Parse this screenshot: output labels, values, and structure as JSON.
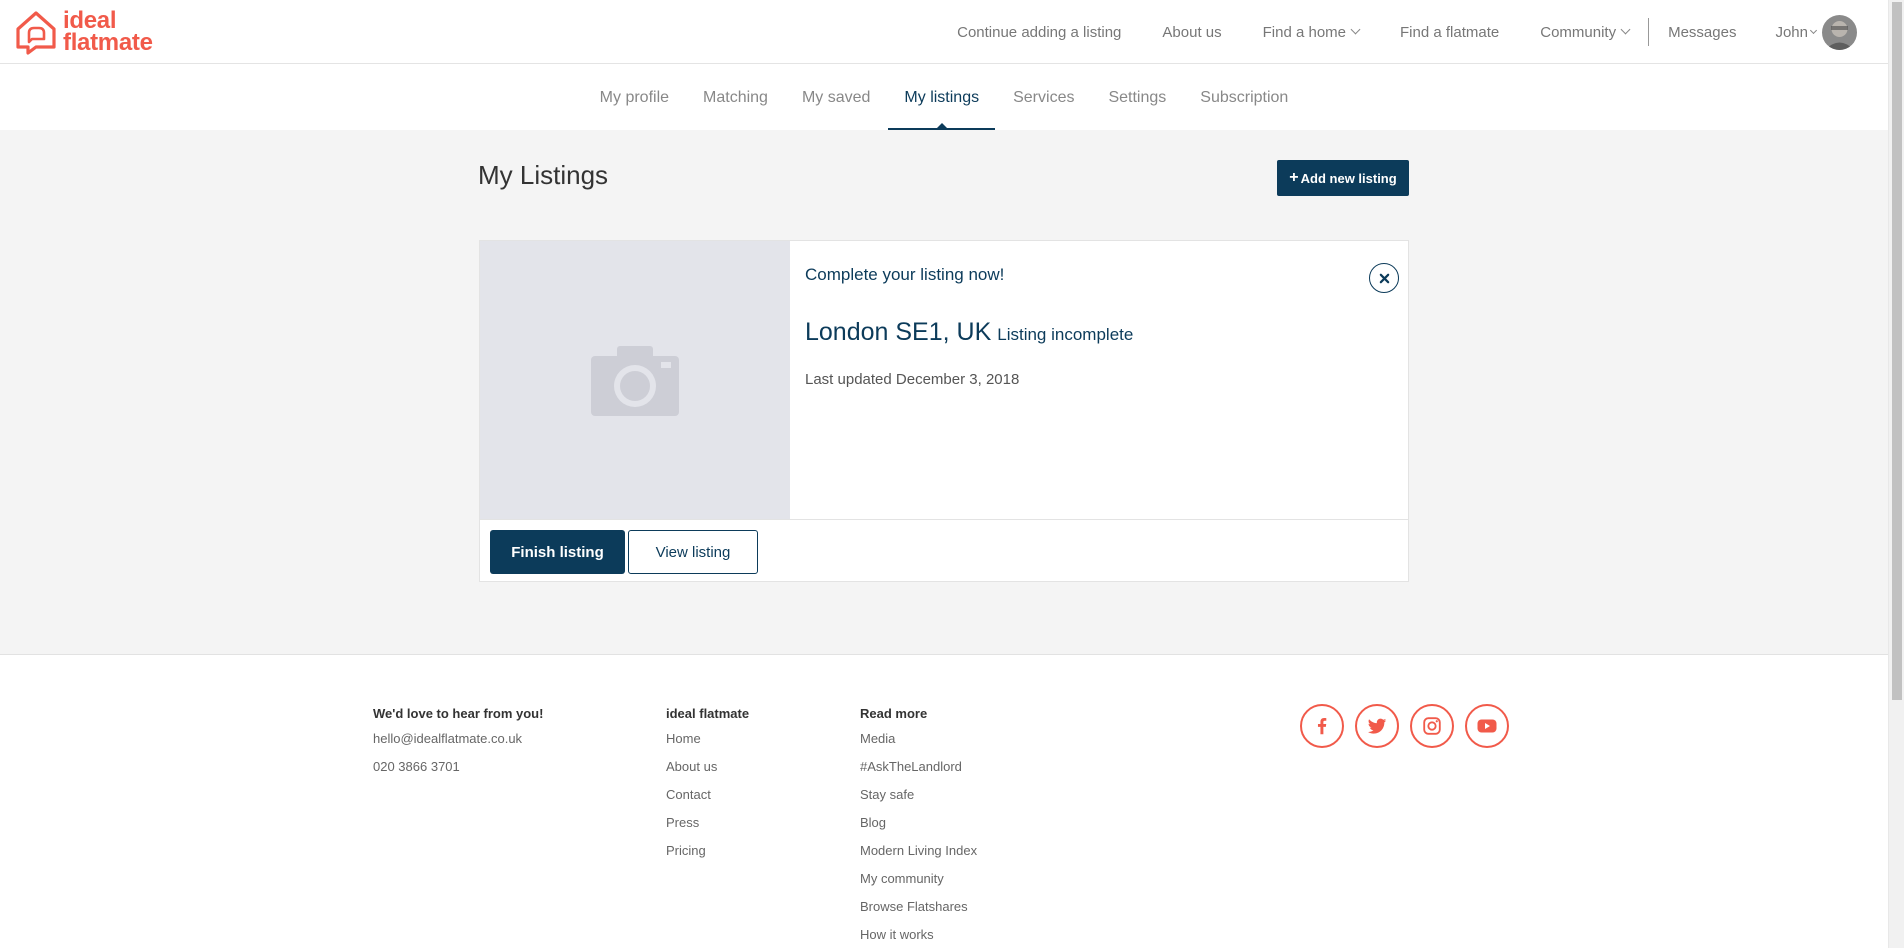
{
  "brand": {
    "name_line1": "ideal",
    "name_line2": "flatmate",
    "color": "#f15a4a"
  },
  "topnav": {
    "items": [
      "Continue adding a listing",
      "About us",
      "Find a home",
      "Find a flatmate",
      "Community",
      "Messages"
    ],
    "user_name": "John"
  },
  "subnav": {
    "tabs": [
      "My profile",
      "Matching",
      "My saved",
      "My listings",
      "Services",
      "Settings",
      "Subscription"
    ],
    "active": "My listings"
  },
  "main": {
    "title": "My Listings",
    "add_button": "Add new listing"
  },
  "listing": {
    "prompt": "Complete your listing now!",
    "location": "London SE1, UK",
    "status": "Listing incomplete",
    "updated": "Last updated December 3, 2018",
    "finish_button": "Finish listing",
    "view_button": "View listing"
  },
  "footer": {
    "contact_heading": "We'd love to hear from you!",
    "email": "hello@idealflatmate.co.uk",
    "phone": "020 3866 3701",
    "company_heading": "ideal flatmate",
    "company_links": [
      "Home",
      "About us",
      "Contact",
      "Press",
      "Pricing"
    ],
    "read_heading": "Read more",
    "read_links": [
      "Media",
      "#AskTheLandlord",
      "Stay safe",
      "Blog",
      "Modern Living Index",
      "My community",
      "Browse Flatshares",
      "How it works"
    ],
    "socials": [
      "facebook-icon",
      "twitter-icon",
      "instagram-icon",
      "youtube-icon"
    ]
  },
  "colors": {
    "primary": "#0c3b5a",
    "accent": "#f15a4a",
    "background": "#f4f4f4"
  }
}
